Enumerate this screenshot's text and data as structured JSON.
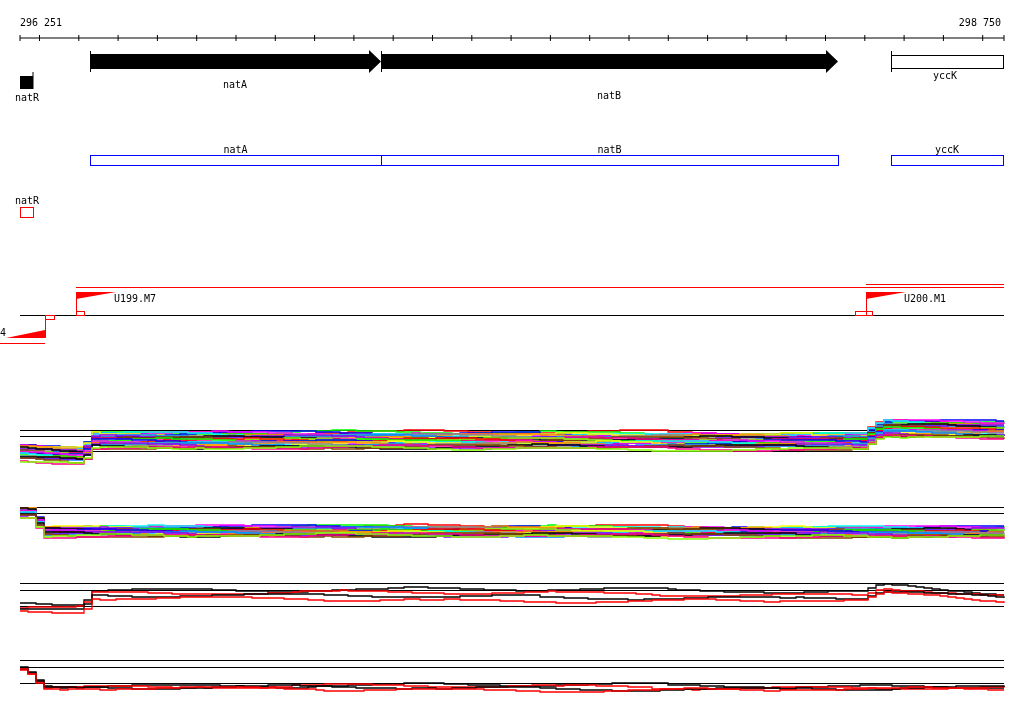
{
  "ruler": {
    "start": "296 251",
    "end": "298 750"
  },
  "gene_track": [
    {
      "label": "natR",
      "kind": "filled"
    },
    {
      "label": "natA",
      "kind": "arrow"
    },
    {
      "label": "natB",
      "kind": "arrow"
    },
    {
      "label": "yccK",
      "kind": "open"
    }
  ],
  "annotation_track": [
    {
      "label": "natA"
    },
    {
      "label": "natB"
    },
    {
      "label": "yccK"
    }
  ],
  "annotation_track_2": [
    {
      "label": "natR"
    }
  ],
  "promoters": [
    {
      "label": "4"
    },
    {
      "label": "U199.M7"
    },
    {
      "label": "U200.M1"
    }
  ],
  "profile_tracks": [
    {
      "kind": "multi"
    },
    {
      "kind": "multi"
    },
    {
      "kind": "pair"
    },
    {
      "kind": "pair"
    }
  ]
}
